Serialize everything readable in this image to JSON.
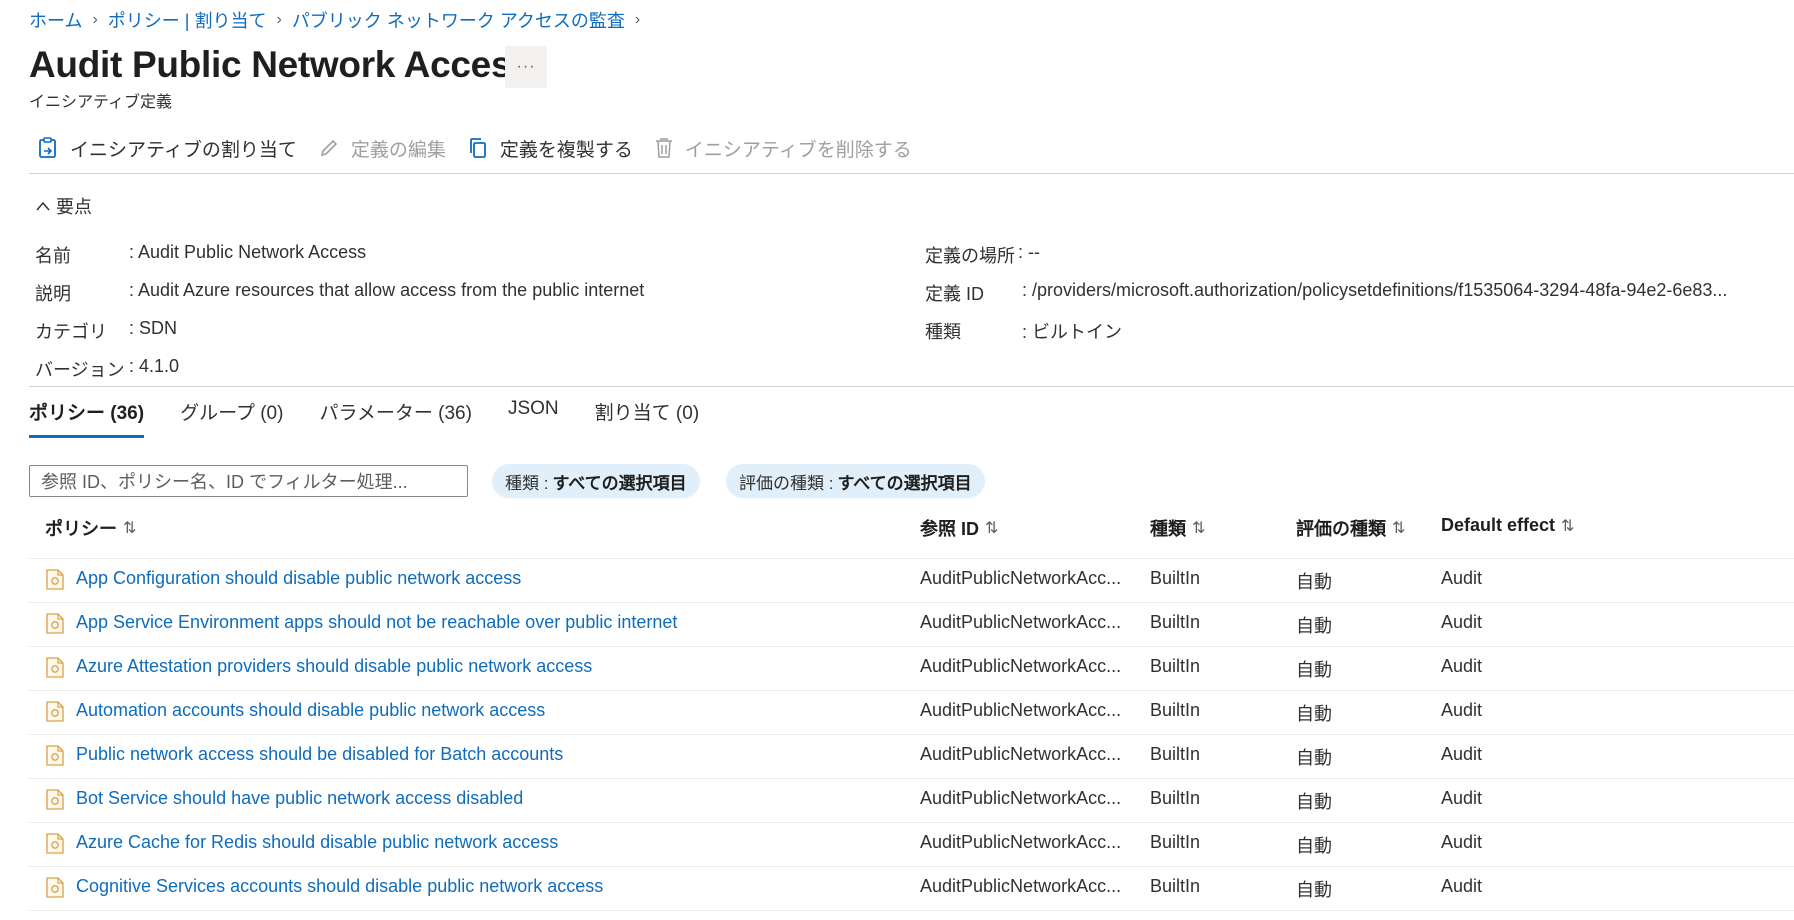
{
  "breadcrumb": [
    "ホーム",
    "ポリシー | 割り当て",
    "パブリック ネットワーク アクセスの監査"
  ],
  "title": "Audit Public Network Access",
  "more_label": "···",
  "subtitle": "イニシアティブ定義",
  "toolbar": {
    "assign": "イニシアティブの割り当て",
    "edit": "定義の編集",
    "duplicate": "定義を複製する",
    "delete": "イニシアティブを削除する"
  },
  "essentials": {
    "toggle_label": "要点",
    "name_label": "名前",
    "name_value": ": Audit Public Network Access",
    "desc_label": "説明",
    "desc_value": ": Audit Azure resources that allow access from the public internet",
    "category_label": "カテゴリ",
    "category_value": ": SDN",
    "version_label": "バージョン",
    "version_value": ": 4.1.0",
    "location_label": "定義の場所",
    "location_value": ": --",
    "defid_label": "定義 ID",
    "defid_value": ": /providers/microsoft.authorization/policysetdefinitions/f1535064-3294-48fa-94e2-6e83...",
    "type_label": "種類",
    "type_value": ": ビルトイン"
  },
  "tabs": [
    "ポリシー (36)",
    "グループ (0)",
    "パラメーター (36)",
    "JSON",
    "割り当て (0)"
  ],
  "filter": {
    "placeholder": "参照 ID、ポリシー名、ID でフィルター処理...",
    "pill1_label": "種類 :",
    "pill1_value": "すべての選択項目",
    "pill2_label": "評価の種類 :",
    "pill2_value": "すべての選択項目"
  },
  "table": {
    "headers": [
      "ポリシー",
      "参照 ID",
      "種類",
      "評価の種類",
      "Default effect"
    ],
    "sort_glyph": "⇅",
    "rows": [
      {
        "policy": "App Configuration should disable public network access",
        "ref": "AuditPublicNetworkAcc...",
        "type": "BuiltIn",
        "eval": "自動",
        "effect": "Audit"
      },
      {
        "policy": "App Service Environment apps should not be reachable over public internet",
        "ref": "AuditPublicNetworkAcc...",
        "type": "BuiltIn",
        "eval": "自動",
        "effect": "Audit"
      },
      {
        "policy": "Azure Attestation providers should disable public network access",
        "ref": "AuditPublicNetworkAcc...",
        "type": "BuiltIn",
        "eval": "自動",
        "effect": "Audit"
      },
      {
        "policy": "Automation accounts should disable public network access",
        "ref": "AuditPublicNetworkAcc...",
        "type": "BuiltIn",
        "eval": "自動",
        "effect": "Audit"
      },
      {
        "policy": "Public network access should be disabled for Batch accounts",
        "ref": "AuditPublicNetworkAcc...",
        "type": "BuiltIn",
        "eval": "自動",
        "effect": "Audit"
      },
      {
        "policy": "Bot Service should have public network access disabled",
        "ref": "AuditPublicNetworkAcc...",
        "type": "BuiltIn",
        "eval": "自動",
        "effect": "Audit"
      },
      {
        "policy": "Azure Cache for Redis should disable public network access",
        "ref": "AuditPublicNetworkAcc...",
        "type": "BuiltIn",
        "eval": "自動",
        "effect": "Audit"
      },
      {
        "policy": "Cognitive Services accounts should disable public network access",
        "ref": "AuditPublicNetworkAcc...",
        "type": "BuiltIn",
        "eval": "自動",
        "effect": "Audit"
      }
    ]
  },
  "colors": {
    "accent": "#0f6cbd",
    "pill_bg": "#e1effa",
    "policy_icon": "#d8a24a"
  }
}
